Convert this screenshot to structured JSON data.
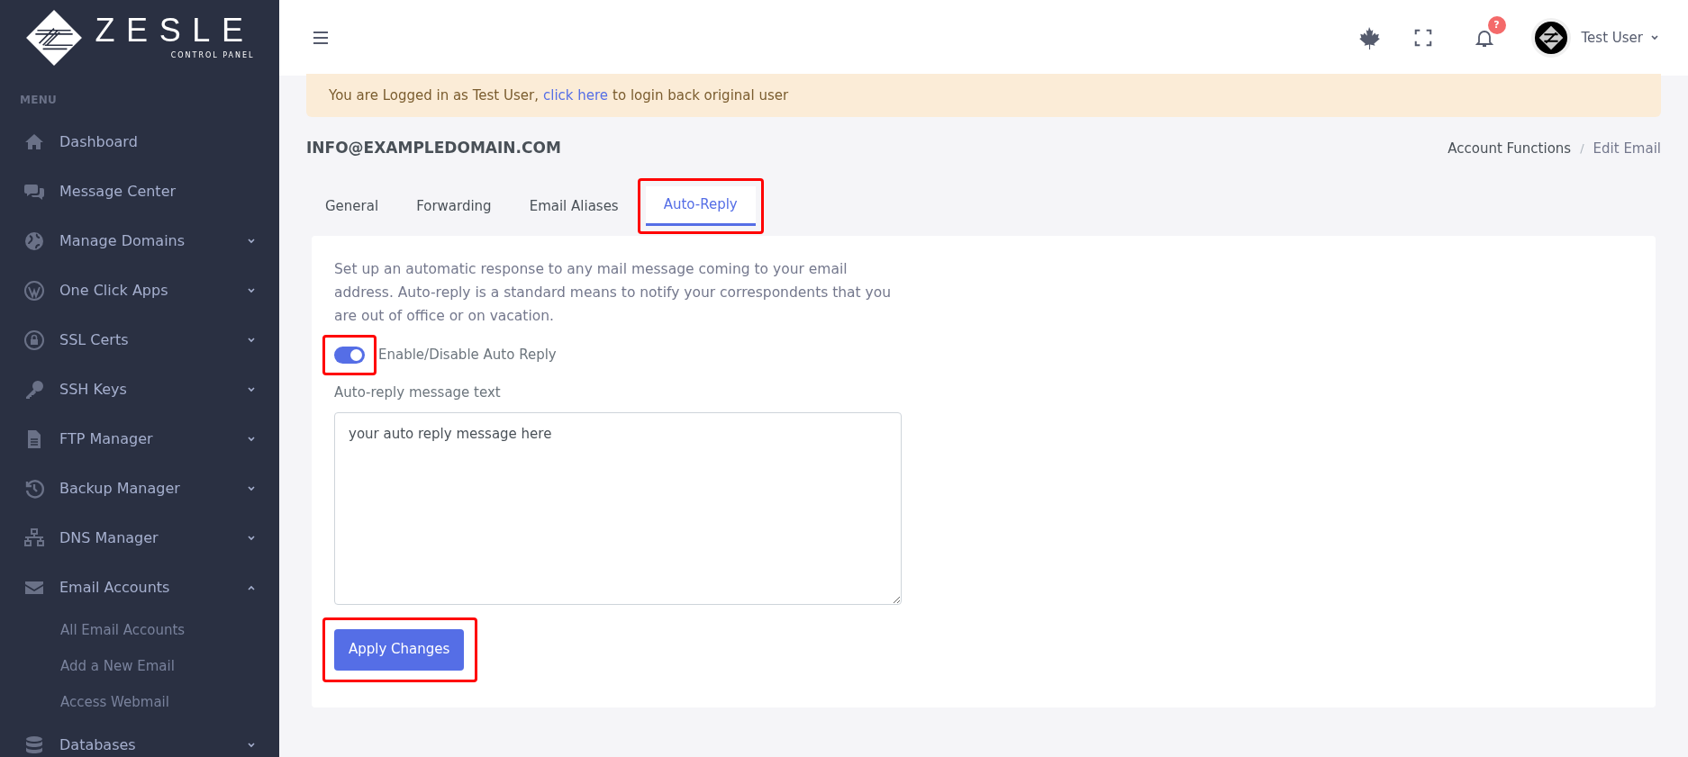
{
  "sidebar": {
    "logo": {
      "name": "ZESLE",
      "tagline": "CONTROL PANEL"
    },
    "menu_heading": "MENU",
    "items": [
      {
        "label": "Dashboard"
      },
      {
        "label": "Message Center"
      },
      {
        "label": "Manage Domains",
        "expanded": false
      },
      {
        "label": "One Click Apps",
        "expanded": false
      },
      {
        "label": "SSL Certs",
        "expanded": false
      },
      {
        "label": "SSH Keys",
        "expanded": false
      },
      {
        "label": "FTP Manager",
        "expanded": false
      },
      {
        "label": "Backup Manager",
        "expanded": false
      },
      {
        "label": "DNS Manager",
        "expanded": false
      },
      {
        "label": "Email Accounts",
        "expanded": true,
        "children": [
          {
            "label": "All Email Accounts"
          },
          {
            "label": "Add a New Email"
          },
          {
            "label": "Access Webmail"
          }
        ]
      },
      {
        "label": "Databases",
        "expanded": false
      }
    ]
  },
  "header": {
    "notification_badge": "?",
    "user_name": "Test User"
  },
  "banner": {
    "text": "You are Logged in as Test User,",
    "link": "click here",
    "text_after": "to login back original user"
  },
  "page_title": "INFO@EXAMPLEDOMAIN.COM",
  "breadcrumb": {
    "items": [
      "Account Functions",
      "Edit Email"
    ],
    "separator": "/"
  },
  "tabs": [
    {
      "label": "General",
      "selected": false,
      "highlighted": false
    },
    {
      "label": "Forwarding",
      "selected": false,
      "highlighted": false
    },
    {
      "label": "Email Aliases",
      "selected": false,
      "highlighted": false
    },
    {
      "label": "Auto-Reply",
      "selected": true,
      "highlighted": true
    }
  ],
  "card": {
    "description": "Set up an automatic response to any mail message coming to your email address. Auto-reply is a standard means to notify your correspondents that you are out of office or on vacation.",
    "toggle": {
      "label": "Enable/Disable Auto Reply",
      "on": true,
      "highlighted": true
    },
    "message_label": "Auto-reply message text",
    "message_value": "your auto reply message here",
    "button": {
      "label": "Apply Changes",
      "highlighted": true
    }
  }
}
